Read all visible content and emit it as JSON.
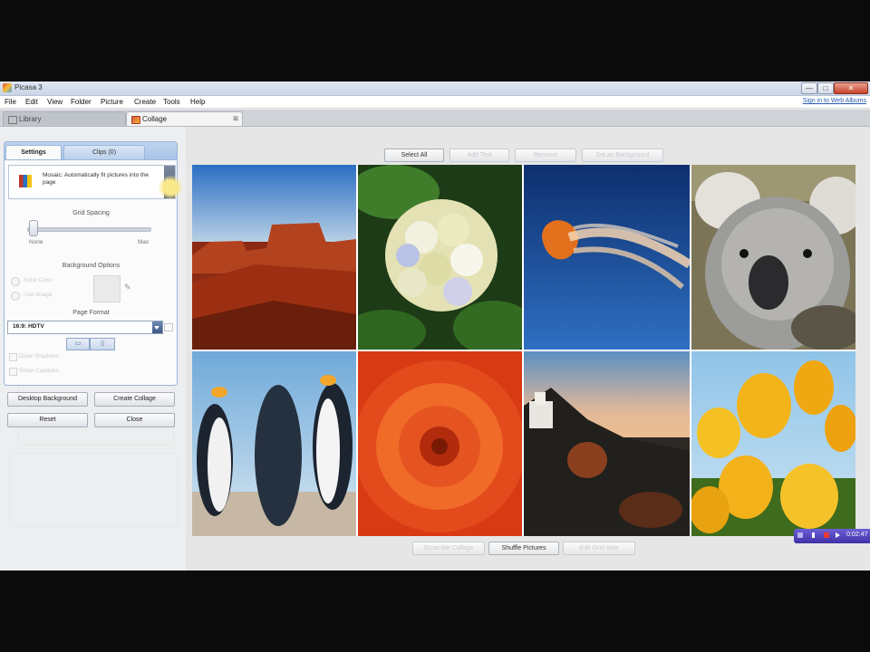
{
  "window": {
    "title": "Picasa 3",
    "min": "—",
    "max": "□",
    "close": "✕"
  },
  "menu": [
    "File",
    "Edit",
    "View",
    "Folder",
    "Picture",
    "Create",
    "Tools",
    "Help"
  ],
  "signin": "Sign in to Web Albums",
  "tabs": {
    "library": "Library",
    "collage": "Collage",
    "close": "⊠"
  },
  "panel": {
    "tab_settings": "Settings",
    "tab_clips": "Clips (0)",
    "layout_description": "Mosaic: Automatically fit pictures into the page",
    "grid_spacing": "Grid Spacing",
    "slider_none": "None",
    "slider_max": "Max",
    "background_options": "Background Options",
    "solid_color": "Solid Color",
    "use_image": "Use Image",
    "page_format": "Page Format",
    "page_format_value": "16:9: HDTV",
    "draw_shadows": "Draw Shadows",
    "show_captions": "Show Captions",
    "btn_desktop": "Desktop Background",
    "btn_create": "Create Collage",
    "btn_reset": "Reset",
    "btn_close": "Close"
  },
  "toolbar_top": {
    "select_all": "Select All",
    "add_text": "Add Text",
    "remove": "Remove",
    "set_background": "Set as Background"
  },
  "toolbar_bottom": {
    "scramble": "Scramble Collage",
    "shuffle": "Shuffle Pictures",
    "edit_grid": "Edit Grid Size"
  },
  "photos": [
    "Desert",
    "Hydrangeas",
    "Jellyfish",
    "Koala",
    "Penguins",
    "Chrysanthemum",
    "Lighthouse",
    "Tulips"
  ],
  "recorder": {
    "time": "0:02:47"
  },
  "colors": {
    "accent": "#9ab7db",
    "rec": "#4a38b8"
  }
}
